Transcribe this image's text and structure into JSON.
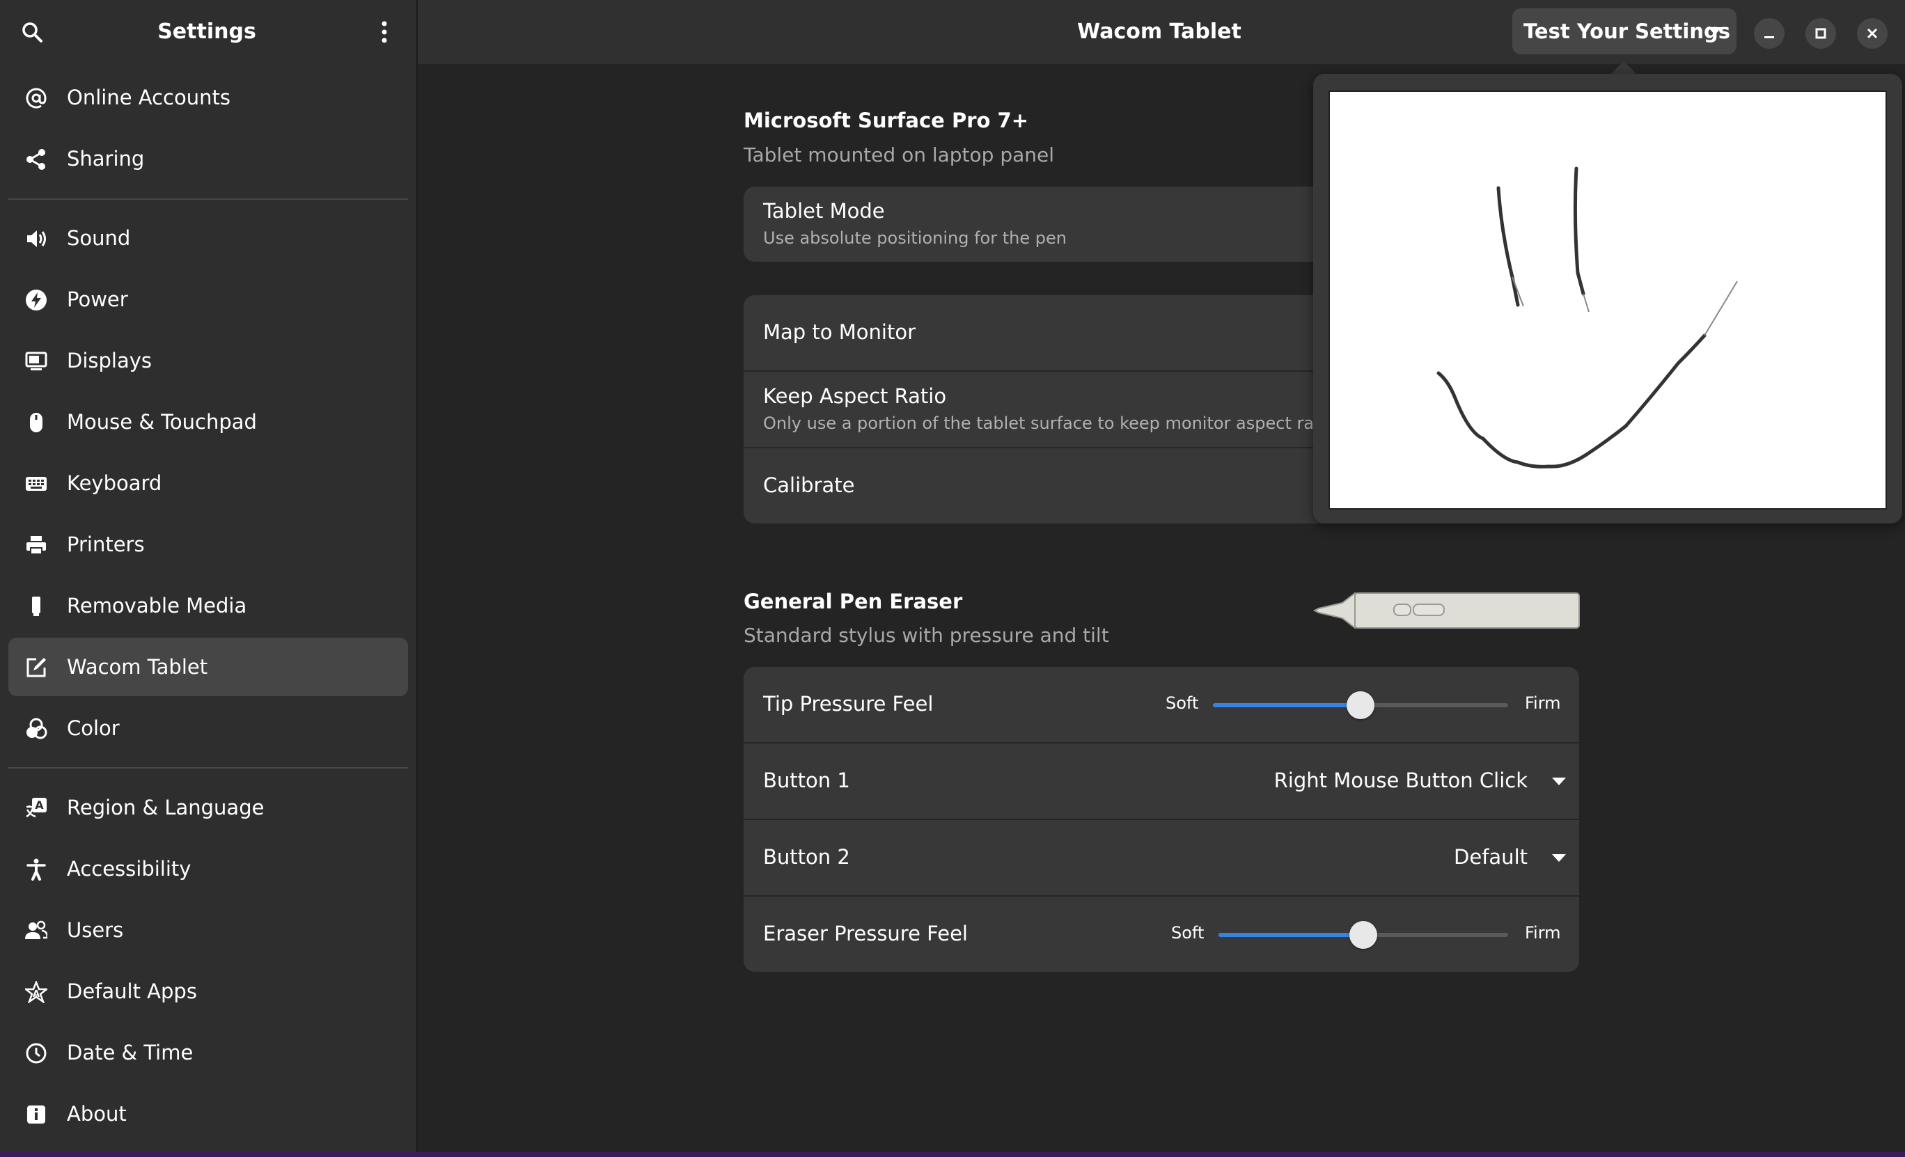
{
  "sidebar": {
    "title": "Settings",
    "items": [
      {
        "label": "Online Accounts",
        "icon": "at-icon"
      },
      {
        "label": "Sharing",
        "icon": "share-icon"
      },
      {
        "label": "Sound",
        "icon": "speaker-icon"
      },
      {
        "label": "Power",
        "icon": "power-icon"
      },
      {
        "label": "Displays",
        "icon": "display-icon"
      },
      {
        "label": "Mouse & Touchpad",
        "icon": "mouse-icon"
      },
      {
        "label": "Keyboard",
        "icon": "keyboard-icon"
      },
      {
        "label": "Printers",
        "icon": "printer-icon"
      },
      {
        "label": "Removable Media",
        "icon": "usb-drive-icon"
      },
      {
        "label": "Wacom Tablet",
        "icon": "tablet-pen-icon",
        "active": true
      },
      {
        "label": "Color",
        "icon": "color-circles-icon"
      },
      {
        "label": "Region & Language",
        "icon": "region-language-icon"
      },
      {
        "label": "Accessibility",
        "icon": "accessibility-icon"
      },
      {
        "label": "Users",
        "icon": "users-icon"
      },
      {
        "label": "Default Apps",
        "icon": "star-apps-icon"
      },
      {
        "label": "Date & Time",
        "icon": "clock-icon"
      },
      {
        "label": "About",
        "icon": "info-icon"
      }
    ]
  },
  "header": {
    "title": "Wacom Tablet",
    "test_button": "Test Your Settings"
  },
  "tablet": {
    "name": "Microsoft Surface Pro 7+",
    "description": "Tablet mounted on laptop panel",
    "tablet_mode_title": "Tablet Mode",
    "tablet_mode_sub": "Use absolute positioning for the pen",
    "map_to_monitor": "Map to Monitor",
    "keep_aspect_title": "Keep Aspect Ratio",
    "keep_aspect_sub": "Only use a portion of the tablet surface to keep monitor aspect ratio",
    "calibrate": "Calibrate"
  },
  "stylus": {
    "name": "General Pen Eraser",
    "description": "Standard stylus with pressure and tilt",
    "tip_pressure": {
      "label": "Tip Pressure Feel",
      "soft": "Soft",
      "firm": "Firm",
      "value": 0.5
    },
    "button1": {
      "label": "Button 1",
      "value": "Right Mouse Button Click"
    },
    "button2": {
      "label": "Button 2",
      "value": "Default"
    },
    "eraser_pressure": {
      "label": "Eraser Pressure Feel",
      "soft": "Soft",
      "firm": "Firm",
      "value": 0.5
    }
  },
  "colors": {
    "accent": "#3584e4",
    "sidebar_bg": "#2e2e2e",
    "content_bg": "#242424",
    "card_bg": "#383838"
  }
}
